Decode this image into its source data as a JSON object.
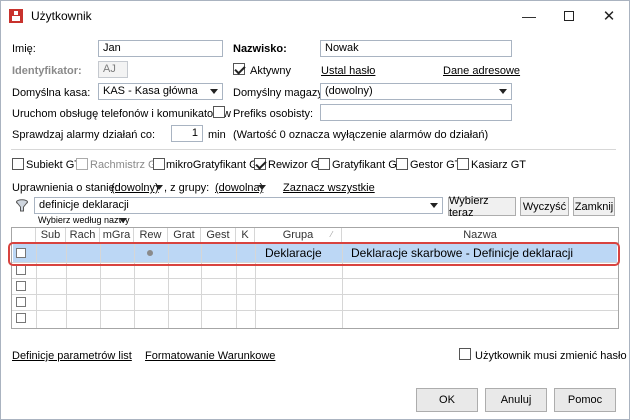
{
  "window": {
    "title": "Użytkownik"
  },
  "form": {
    "imie_label": "Imię:",
    "imie_value": "Jan",
    "nazwisko_label": "Nazwisko:",
    "nazwisko_value": "Nowak",
    "identyfikator_label": "Identyfikator:",
    "identyfikator_value": "AJ",
    "aktywny_label": "Aktywny",
    "ustal_haslo": "Ustal hasło",
    "dane_adresowe": "Dane adresowe",
    "kasa_label": "Domyślna kasa:",
    "kasa_value": "KAS - Kasa główna",
    "magazyn_label": "Domyślny magazyn:",
    "magazyn_value": "(dowolny)",
    "telefony_label": "Uruchom obsługę telefonów i komunikatorów",
    "prefiks_label": "Prefiks osobisty:",
    "alarmy_label": "Sprawdzaj alarmy działań co:",
    "alarmy_value": "1",
    "alarmy_unit": "min",
    "alarmy_note": "(Wartość 0 oznacza wyłączenie alarmów do działań)"
  },
  "roles": [
    {
      "label": "Subiekt GT",
      "checked": false,
      "disabled": false
    },
    {
      "label": "Rachmistrz GT",
      "checked": false,
      "disabled": true
    },
    {
      "label": "mikroGratyfikant GT",
      "checked": false,
      "disabled": false
    },
    {
      "label": "Rewizor GT",
      "checked": true,
      "disabled": false
    },
    {
      "label": "Gratyfikant GT",
      "checked": false,
      "disabled": false
    },
    {
      "label": "Gestor GT",
      "checked": false,
      "disabled": false
    },
    {
      "label": "Kasiarz GT",
      "checked": false,
      "disabled": false
    }
  ],
  "permissions": {
    "state_label": "Uprawnienia o stanie:",
    "state_value": "(dowolny)",
    "group_label": ", z grupy:",
    "group_value": "(dowolna)",
    "select_all": "Zaznacz wszystkie",
    "search_value": "definicje deklaracji",
    "search_by": "Wybierz według nazwy",
    "choose_now": "Wybierz teraz",
    "clear": "Wyczyść",
    "close": "Zamknij"
  },
  "grid": {
    "columns": [
      "Sub",
      "Rach",
      "mGra",
      "Rew",
      "Grat",
      "Gest",
      "K",
      "Grupa",
      "Nazwa"
    ],
    "rows": [
      {
        "grupa": "Deklaracje",
        "nazwa": "Deklaracje skarbowe - Definicje deklaracji",
        "rew_marked": true,
        "selected": true
      },
      {
        "grupa": "",
        "nazwa": ""
      },
      {
        "grupa": "",
        "nazwa": ""
      },
      {
        "grupa": "",
        "nazwa": ""
      },
      {
        "grupa": "",
        "nazwa": ""
      }
    ]
  },
  "footer": {
    "param_defs": "Definicje parametrów list",
    "cond_format": "Formatowanie Warunkowe",
    "must_change_pwd": "Użytkownik musi zmienić hasło",
    "ok": "OK",
    "cancel": "Anuluj",
    "help": "Pomoc"
  },
  "colors": {
    "selection": "#bcd7f5",
    "highlight": "#d8433f"
  }
}
